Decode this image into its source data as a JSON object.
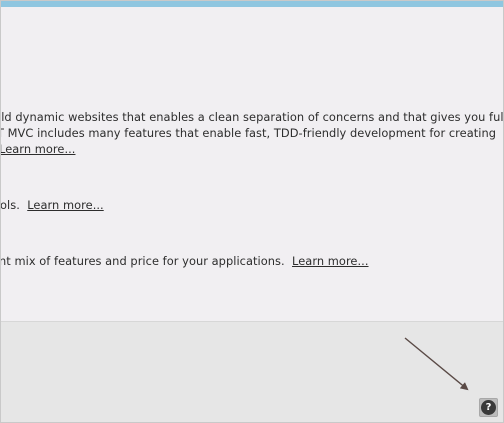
{
  "content": {
    "line1": "ild dynamic websites that enables a clean separation of concerns and that gives you full",
    "line2": "T MVC includes many features that enable fast, TDD-friendly development for creating",
    "line3_link": "Learn more...",
    "line4_prefix": "ols.",
    "line4_link": "Learn more...",
    "line5_prefix": "nt mix of features and price for your applications.",
    "line5_link": "Learn more..."
  },
  "help_button": {
    "icon": "help-icon",
    "glyph": "?"
  },
  "colors": {
    "accent_bar": "#8fc6e0",
    "content_bg": "#f1eff2",
    "bottom_bg": "#e6e6e6",
    "text": "#2d2d2d",
    "annotation_arrow": "#5a4a46"
  }
}
